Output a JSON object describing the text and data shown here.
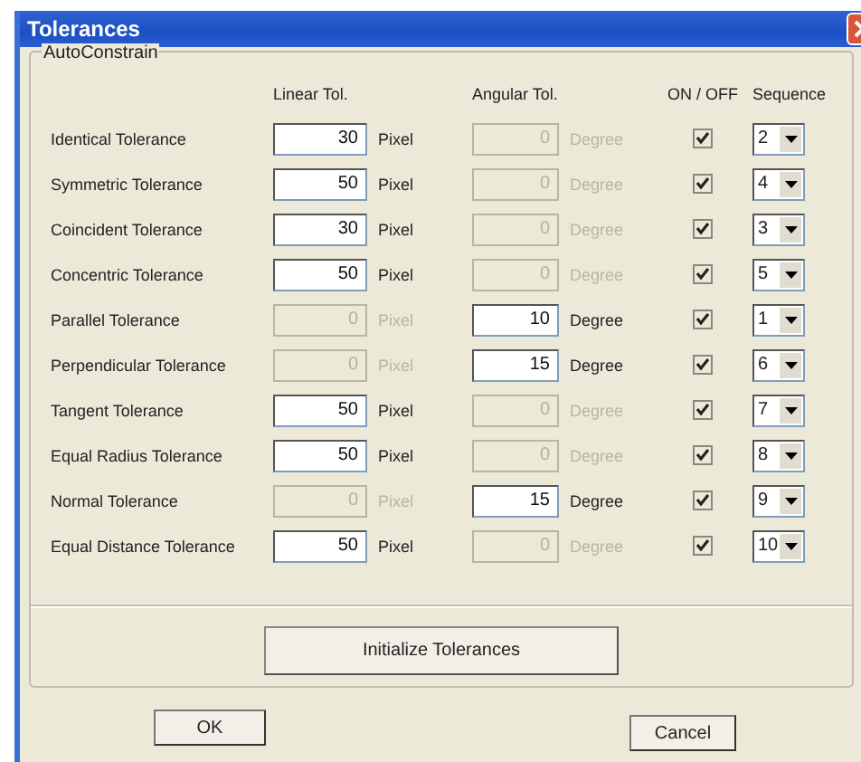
{
  "window": {
    "title": "Tolerances"
  },
  "group": {
    "title": "AutoConstrain",
    "headers": [
      "Linear Tol.",
      "Angular Tol.",
      "ON / OFF",
      "Sequence"
    ]
  },
  "rows": [
    {
      "label": "Identical Tolerance",
      "linear": {
        "value": "30",
        "unit": "Pixel",
        "disabled": false
      },
      "angular": {
        "value": "0",
        "unit": "Degree",
        "disabled": true
      },
      "checked": true,
      "sequence": "2"
    },
    {
      "label": "Symmetric Tolerance",
      "linear": {
        "value": "50",
        "unit": "Pixel",
        "disabled": false
      },
      "angular": {
        "value": "0",
        "unit": "Degree",
        "disabled": true
      },
      "checked": true,
      "sequence": "4"
    },
    {
      "label": "Coincident Tolerance",
      "linear": {
        "value": "30",
        "unit": "Pixel",
        "disabled": false
      },
      "angular": {
        "value": "0",
        "unit": "Degree",
        "disabled": true
      },
      "checked": true,
      "sequence": "3"
    },
    {
      "label": "Concentric Tolerance",
      "linear": {
        "value": "50",
        "unit": "Pixel",
        "disabled": false
      },
      "angular": {
        "value": "0",
        "unit": "Degree",
        "disabled": true
      },
      "checked": true,
      "sequence": "5"
    },
    {
      "label": "Parallel Tolerance",
      "linear": {
        "value": "0",
        "unit": "Pixel",
        "disabled": true
      },
      "angular": {
        "value": "10",
        "unit": "Degree",
        "disabled": false
      },
      "checked": true,
      "sequence": "1"
    },
    {
      "label": "Perpendicular Tolerance",
      "linear": {
        "value": "0",
        "unit": "Pixel",
        "disabled": true
      },
      "angular": {
        "value": "15",
        "unit": "Degree",
        "disabled": false
      },
      "checked": true,
      "sequence": "6"
    },
    {
      "label": "Tangent Tolerance",
      "linear": {
        "value": "50",
        "unit": "Pixel",
        "disabled": false
      },
      "angular": {
        "value": "0",
        "unit": "Degree",
        "disabled": true
      },
      "checked": true,
      "sequence": "7"
    },
    {
      "label": "Equal Radius Tolerance",
      "linear": {
        "value": "50",
        "unit": "Pixel",
        "disabled": false
      },
      "angular": {
        "value": "0",
        "unit": "Degree",
        "disabled": true
      },
      "checked": true,
      "sequence": "8"
    },
    {
      "label": "Normal Tolerance",
      "linear": {
        "value": "0",
        "unit": "Pixel",
        "disabled": true
      },
      "angular": {
        "value": "15",
        "unit": "Degree",
        "disabled": false
      },
      "checked": true,
      "sequence": "9"
    },
    {
      "label": "Equal Distance Tolerance",
      "linear": {
        "value": "50",
        "unit": "Pixel",
        "disabled": false
      },
      "angular": {
        "value": "0",
        "unit": "Degree",
        "disabled": true
      },
      "checked": true,
      "sequence": "10"
    }
  ],
  "init_button": "Initialize Tolerances",
  "buttons": [
    "OK",
    "Cancel"
  ]
}
